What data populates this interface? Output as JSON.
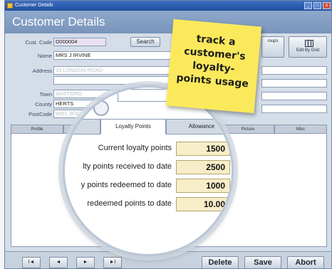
{
  "window": {
    "title": "Customer Details",
    "min": "_",
    "max": "□",
    "close": "x"
  },
  "header": {
    "title": "Customer Details"
  },
  "form": {
    "cust_code_label": "Cust. Code",
    "cust_code_value": "D000004",
    "search_label": "Search",
    "name_label": "Name",
    "name_value": "MRS J IRVINE",
    "address_label": "Address",
    "address_value": "33 LONDON ROAD",
    "town_label": "Town",
    "town_value": "WATFORD",
    "county_label": "County",
    "county_value": "HERTS",
    "postcode_label": "PostCode",
    "postcode_value": "WD1 3FD",
    "em_label": "Em",
    "groups_label": "roups",
    "edit_by_grid_label": "Edit By Grid"
  },
  "tabs": [
    "Profile",
    "",
    "Loyalty Points",
    "Allowance",
    "Picture",
    "Misc"
  ],
  "loyalty": {
    "rows": [
      {
        "label": "Current loyalty points",
        "value": "1500"
      },
      {
        "label": "lty points received to date",
        "value": "2500"
      },
      {
        "label": "y points redeemed to date",
        "value": "1000"
      },
      {
        "label": "redeemed points to date",
        "value": "10.00"
      }
    ]
  },
  "nav": {
    "first": "I◄",
    "prev": "◄",
    "next": "►",
    "last": "►I"
  },
  "actions": {
    "delete": "Delete",
    "save": "Save",
    "abort": "Abort"
  },
  "sticky": {
    "line1": "track a",
    "line2": "customer's",
    "line3": "loyalty-",
    "line4": "points usage"
  }
}
